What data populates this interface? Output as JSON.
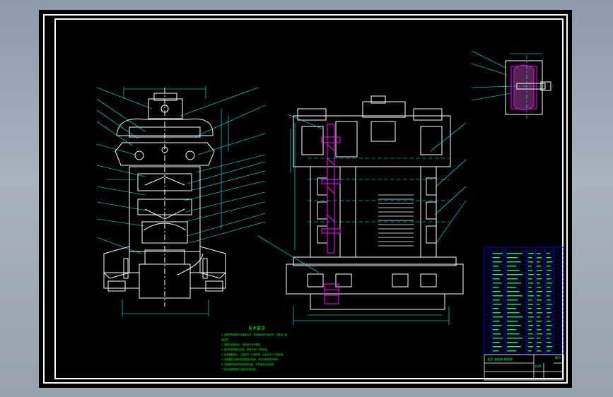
{
  "drawing": {
    "type": "mechanical-assembly-drawing",
    "views": [
      "side-section-view",
      "front-section-view",
      "detail-view-gear"
    ],
    "colors": {
      "background": "#000000",
      "border": "#ffffff",
      "geometry": "#ffffff",
      "dimensions": "#00ffff",
      "leaders": "#00ffff",
      "notes": "#00ff00",
      "section_hatch": "#ff00ff",
      "table_grid": "#0000ff",
      "table_text": "#00ff66"
    }
  },
  "notes": {
    "title": "技术要求",
    "lines": [
      "1. 装配前所有零件用煤油清洗，滚动轴承用汽油清洗，内壁涂上耐",
      "   油油漆；",
      "2. 装配后各配合处，密封处不允许漏油；",
      "3. 啮合侧隙用铅丝检验，侧隙不得小于规定值；",
      "4. 检查接触斑点，沿齿高不少于规定值，沿齿长不少于规定值；",
      "5. 减速器剖分面涂密封胶或水玻璃，不允许使用任何填料；",
      "6. 减速器内装润滑油至规定高度，外表面涂灰色油漆。",
      "7. 按试验规范进行空载及负载试验。"
    ]
  },
  "title_block": {
    "line1": "某型 减速器 装配图",
    "line2": "比例",
    "line3": "图号"
  }
}
